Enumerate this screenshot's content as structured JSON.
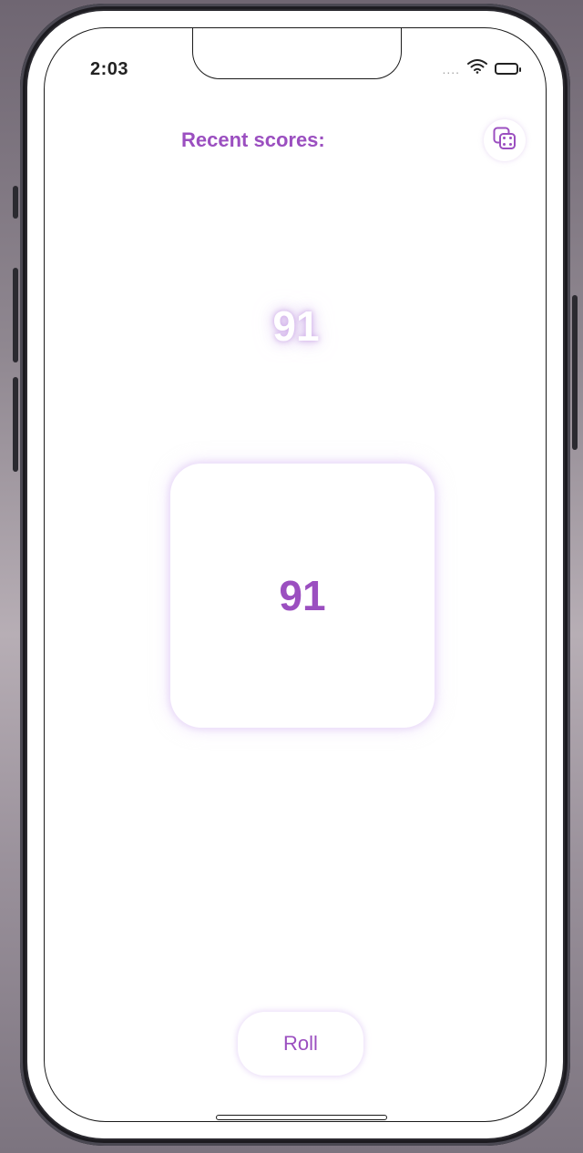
{
  "status_bar": {
    "time": "2:03",
    "signal": "....",
    "wifi_icon": "wifi-icon",
    "battery_icon": "battery-icon"
  },
  "header": {
    "recent_label": "Recent scores:",
    "history_button_icon": "dice-icon"
  },
  "main": {
    "recent_score": "91",
    "current_score": "91"
  },
  "actions": {
    "roll_label": "Roll"
  },
  "colors": {
    "accent": "#9b4fc0",
    "glow": "#e1cdf5",
    "background": "#ffffff"
  }
}
